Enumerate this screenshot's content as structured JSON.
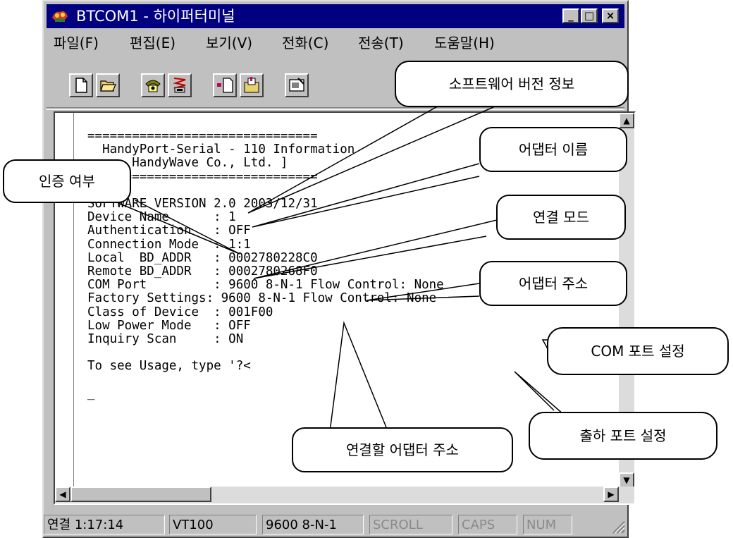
{
  "window": {
    "title": "BTCOM1 - 하이퍼터미널",
    "minimize": "_",
    "maximize": "□",
    "close": "×"
  },
  "menu": [
    "파일(F)",
    "편집(E)",
    "보기(V)",
    "전화(C)",
    "전송(T)",
    "도움말(H)"
  ],
  "toolbar": [
    "new-icon",
    "open-icon",
    "dial-icon",
    "disconnect-icon",
    "send-icon",
    "receive-icon",
    "properties-icon"
  ],
  "terminal": {
    "lines": [
      "===============================",
      "  HandyPort-Serial - 110 Information",
      "      HandyWave Co., Ltd. ]",
      "===============================",
      "",
      "SOFTWARE VERSION 2.0 2003/12/31",
      "Device Name      : 1",
      "Authentication   : OFF",
      "Connection Mode  : 1:1",
      "Local  BD_ADDR   : 0002780228C0",
      "Remote BD_ADDR   : 0002780268F0",
      "COM Port         : 9600 8-N-1 Flow Control: None",
      "Factory Settings: 9600 8-N-1 Flow Control: None",
      "Class of Device  : 001F00",
      "Low Power Mode   : OFF",
      "Inquiry Scan     : ON",
      "",
      "To see Usage, type '?<",
      "",
      "_"
    ]
  },
  "status": {
    "connected": "연결 1:17:14",
    "emulation": "VT100",
    "settings": "9600 8-N-1",
    "scroll": "SCROLL",
    "caps": "CAPS",
    "num": "NUM"
  },
  "callouts": {
    "software_version": "소프트웨어 버전 정보",
    "adapter_name": "어댑터 이름",
    "authentication": "인증 여부",
    "connection_mode": "연결 모드",
    "adapter_address": "어댑터 주소",
    "com_port": "COM 포트 설정",
    "remote_address": "연결할 어댑터 주소",
    "factory_port": "출하 포트 설정"
  }
}
